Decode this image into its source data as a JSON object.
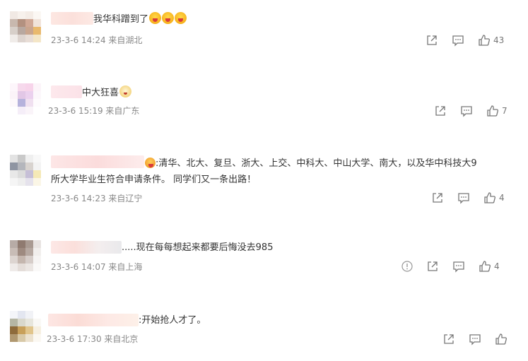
{
  "comments": [
    {
      "text_suffix": "我华科蹭到了",
      "timestamp": "23-3-6 14:24 来自湖北",
      "like_count": "43"
    },
    {
      "text_suffix": "中大狂喜",
      "timestamp": "23-3-6 15:19 来自广东",
      "like_count": "7"
    },
    {
      "text_line1": ":清华、北大、复旦、浙大、上交、中科大、中山大学、南大，以及华中科技大9",
      "text_line2": "所大学毕业生符合申请条件。 同学们又一条出路！",
      "timestamp": "23-3-6 14:23 来自辽宁",
      "like_count": "4"
    },
    {
      "text_suffix": ".....现在每每想起来都要后悔没去985",
      "timestamp": "23-3-6 14:07 来自上海",
      "like_count": "4"
    },
    {
      "text_suffix": ":开始抢人才了。",
      "timestamp": "23-3-6 17:30 来自北京",
      "like_count": ""
    }
  ],
  "icons": {
    "share": "share-icon",
    "comment": "comment-icon",
    "like": "thumbs-up-icon",
    "report": "report-icon"
  },
  "colors": {
    "text": "#333333",
    "meta": "#888888",
    "icon": "#777777"
  }
}
